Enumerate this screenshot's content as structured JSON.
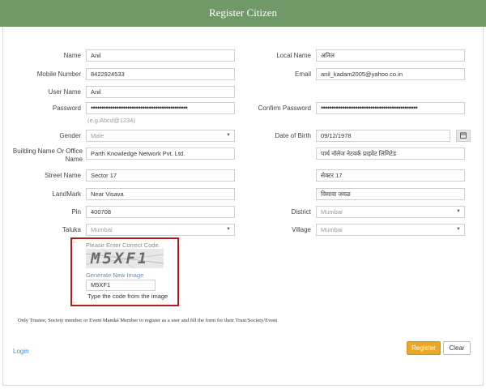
{
  "header": {
    "title": "Register Citizen"
  },
  "form": {
    "name": {
      "label": "Name",
      "value": "Anil"
    },
    "local_name": {
      "label": "Local Name",
      "value": "अनिल"
    },
    "mobile": {
      "label": "Mobile Number",
      "value": "8422924533"
    },
    "email": {
      "label": "Email",
      "value": "anil_kadam2005@yahoo.co.in"
    },
    "username": {
      "label": "User Name",
      "value": "Anil"
    },
    "password": {
      "label": "Password",
      "value": "•••••••••••••••••••••••••••••••••••••••••••••",
      "hint": "(e.g.Abcd@1234)"
    },
    "confirm_password": {
      "label": "Confirm Password",
      "value": "•••••••••••••••••••••••••••••••••••••••••••••"
    },
    "gender": {
      "label": "Gender",
      "value": "Male"
    },
    "dob": {
      "label": "Date of Birth",
      "value": "09/12/1978"
    },
    "building": {
      "label": "Building Name Or Office Name",
      "value": "Parth Knowledge Network Pvt. Ltd.",
      "local_value": "पार्थ नॉलेज नेटवर्क प्राइवेट लिमिटेड"
    },
    "street": {
      "label": "Street Name",
      "value": "Sector 17",
      "local_value": "सेक्टर 17"
    },
    "landmark": {
      "label": "LandMark",
      "value": "Near Visava",
      "local_value": "विसावा जवळ"
    },
    "pin": {
      "label": "Pin",
      "value": "400708"
    },
    "district": {
      "label": "District",
      "value": "Mumbai"
    },
    "taluka": {
      "label": "Taluka",
      "value": "Mumbai"
    },
    "village": {
      "label": "Village",
      "value": "Mumbai"
    }
  },
  "captcha": {
    "prompt": "Please Enter Correct Code.",
    "image_text": "M5XF1",
    "generate_link": "Generate New Image",
    "input_value": "M5XF1",
    "instruction": "Type the code from the image"
  },
  "note": "Only Trustee, Society member or Event Mandal Member to register as a user and fill the form for their Trust/Society/Event",
  "footer": {
    "login": "Login",
    "register": "Register",
    "clear": "Clear"
  },
  "colors": {
    "header_bg": "#6f9a68",
    "register_btn": "#e8a92a",
    "captcha_border": "#b51b1b",
    "link": "#4a86c5"
  }
}
